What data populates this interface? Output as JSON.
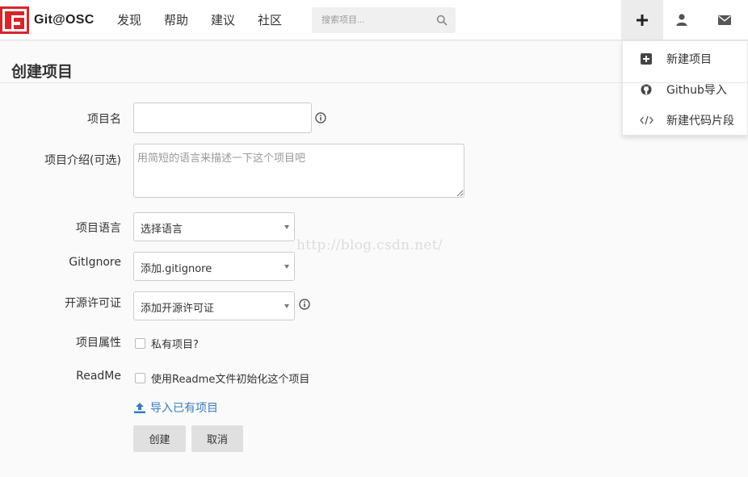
{
  "brand": {
    "name": "Git@OSC"
  },
  "nav": {
    "items": [
      "发现",
      "帮助",
      "建议",
      "社区"
    ]
  },
  "search": {
    "placeholder": "搜索项目..."
  },
  "top_actions": {
    "active": "plus-icon"
  },
  "dropdown": {
    "items": [
      {
        "label": "新建项目",
        "icon": "plus-square-icon"
      },
      {
        "label": "Github导入",
        "icon": "github-icon"
      },
      {
        "label": "新建代码片段",
        "icon": "code-icon"
      }
    ]
  },
  "page": {
    "title": "创建项目"
  },
  "form": {
    "name_label": "项目名",
    "name_value": "",
    "intro_label": "项目介绍(可选)",
    "intro_placeholder": "用简短的语言来描述一下这个项目吧",
    "language_label": "项目语言",
    "language_value": "选择语言",
    "gitignore_label": "GitIgnore",
    "gitignore_value": "添加.gitignore",
    "license_label": "开源许可证",
    "license_value": "添加开源许可证",
    "attr_label": "项目属性",
    "private_label": "私有项目?",
    "private_checked": false,
    "readme_label": "ReadMe",
    "readme_checkbox_label": "使用Readme文件初始化这个项目",
    "readme_checked": false,
    "import_link": "导入已有项目",
    "create_button": "创建",
    "cancel_button": "取消"
  },
  "watermark": "http://blog.csdn.net/",
  "colors": {
    "accent": "#3a7bbf",
    "logo_red": "#d7262a"
  }
}
